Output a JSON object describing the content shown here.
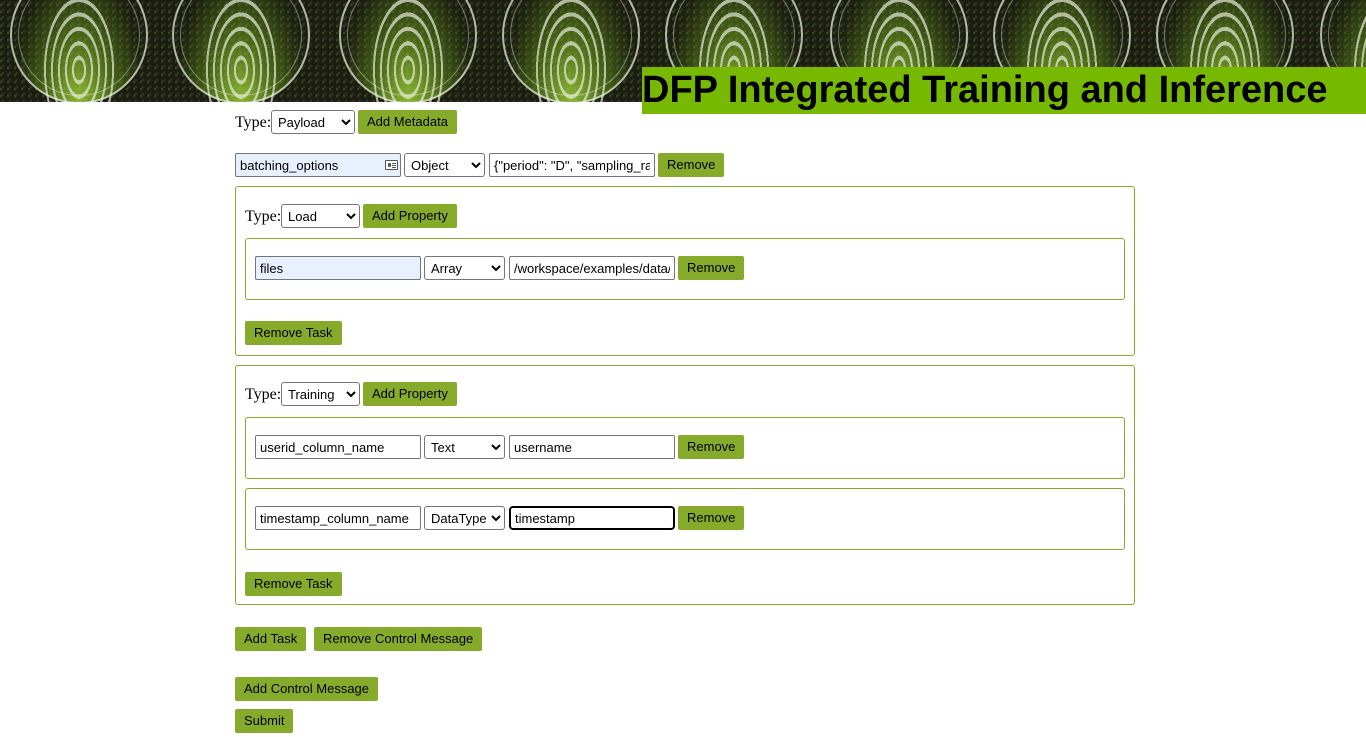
{
  "header": {
    "title": "DFP Integrated Training and Inference"
  },
  "payload": {
    "type_label": "Type:",
    "type_value": "Payload",
    "add_metadata_label": "Add Metadata",
    "metadata": {
      "key": "batching_options",
      "datatype": "Object",
      "value": "{\"period\": \"D\", \"sampling_rate",
      "remove_label": "Remove"
    }
  },
  "tasks": [
    {
      "type_label": "Type:",
      "type_value": "Load",
      "add_property_label": "Add Property",
      "properties": [
        {
          "key": "files",
          "datatype": "Array",
          "value": "/workspace/examples/data/df",
          "remove_label": "Remove"
        }
      ],
      "remove_task_label": "Remove Task"
    },
    {
      "type_label": "Type:",
      "type_value": "Training",
      "add_property_label": "Add Property",
      "properties": [
        {
          "key": "userid_column_name",
          "datatype": "Text",
          "value": "username",
          "remove_label": "Remove"
        },
        {
          "key": "timestamp_column_name",
          "datatype": "DataType",
          "value": "timestamp",
          "remove_label": "Remove"
        }
      ],
      "remove_task_label": "Remove Task"
    }
  ],
  "actions": {
    "add_task_label": "Add Task",
    "remove_control_message_label": "Remove Control Message",
    "add_control_message_label": "Add Control Message",
    "submit_label": "Submit"
  },
  "colors": {
    "accent": "#86ab2a",
    "title_bg": "#76b900"
  }
}
